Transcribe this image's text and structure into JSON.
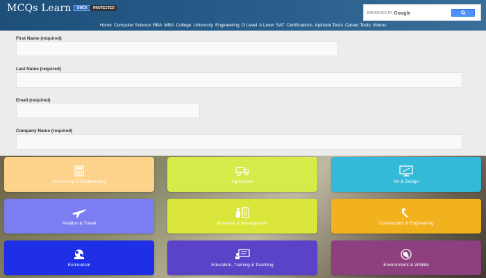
{
  "header": {
    "logo": "MCQs Learn",
    "badge_dmca": "DMCA",
    "badge_protected": "PROTECTED",
    "search": {
      "prefix": "ENHANCED BY",
      "brand": "Google"
    },
    "nav": [
      "Home",
      "Computer Science",
      "BBA",
      "MBA",
      "College",
      "University",
      "Engineering",
      "O Level",
      "A Level",
      "SAT",
      "Certifications",
      "Aptitude Tests",
      "Career Tests",
      "Videos"
    ]
  },
  "form": {
    "first_name_label": "First Name (required)",
    "last_name_label": "Last Name (required)",
    "email_label": "Email (required)",
    "company_label": "Company Name (required)"
  },
  "categories": [
    {
      "label": "Accounting & Bookkeeping",
      "color": "#fdd28a",
      "icon": "calculator-icon"
    },
    {
      "label": "Agriculture",
      "color": "#d6ea4a",
      "icon": "tractor-icon"
    },
    {
      "label": "Art & Design",
      "color": "#35b9d8",
      "icon": "monitor-icon"
    },
    {
      "label": "Aviation & Travel",
      "color": "#7b7ef0",
      "icon": "airplane-icon"
    },
    {
      "label": "Business & Management",
      "color": "#dbe63a",
      "icon": "business-icon"
    },
    {
      "label": "Construction & Engineering",
      "color": "#f2b21e",
      "icon": "wrench-icon"
    },
    {
      "label": "Ecotourism",
      "color": "#1f2fe6",
      "icon": "globe-people-icon"
    },
    {
      "label": "Education, Training & Teaching",
      "color": "#5a43c6",
      "icon": "teacher-icon"
    },
    {
      "label": "Environment & Wildlife",
      "color": "#8e3f7f",
      "icon": "earth-icon"
    }
  ]
}
